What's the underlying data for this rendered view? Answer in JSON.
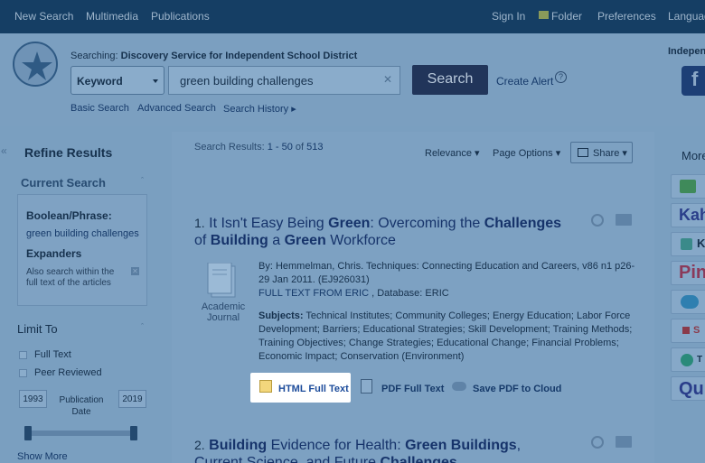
{
  "topnav": {
    "new_search": "New Search",
    "multimedia": "Multimedia",
    "publications": "Publications",
    "sign_in": "Sign In",
    "folder": "Folder",
    "preferences": "Preferences",
    "languages": "Languag"
  },
  "search": {
    "searching_prefix": "Searching:",
    "searching_target": "Discovery Service for Independent School District",
    "field": "Keyword",
    "query": "green building challenges",
    "button": "Search",
    "create_alert": "Create Alert",
    "help": "?",
    "basic": "Basic Search",
    "advanced": "Advanced Search",
    "history": "Search History ▸"
  },
  "header_right": {
    "independ": "Indepen",
    "facebook": "f"
  },
  "sidebar": {
    "collapse": "«",
    "refine_title": "Refine Results",
    "current_search": "Current Search",
    "boolean_label": "Boolean/Phrase:",
    "boolean_value": "green building challenges",
    "expanders_label": "Expanders",
    "expanders_value": "Also search within the full text of the articles",
    "limit_to": "Limit To",
    "full_text": "Full Text",
    "peer_reviewed": "Peer Reviewed",
    "year_from": "1993",
    "year_to": "2019",
    "pub_date": "Publication Date",
    "show_more": "Show More",
    "date_range": [
      0,
      1
    ]
  },
  "results_bar": {
    "prefix": "Search Results: ",
    "range": "1 - 50",
    "of": " of ",
    "total": "513",
    "relevance": "Relevance ▾",
    "page_options": "Page Options ▾",
    "share": "Share ▾"
  },
  "results": [
    {
      "num": "1.",
      "t1": "It Isn't Easy Being ",
      "t2": "Green",
      "t3": ": Overcoming the ",
      "t4": "Challenges",
      "t5": "of ",
      "t6": "Building",
      "t7": " a ",
      "t8": "Green",
      "t9": " Workforce",
      "pub_type": "Academic Journal",
      "byline": "By: Hemmelman, Chris. Techniques: Connecting Education and Careers, v86 n1 p26-29 Jan 2011. (EJ926031)",
      "fulltext_from": "FULL TEXT FROM ERIC",
      "database": " , Database: ERIC",
      "subjects_label": "Subjects:",
      "subjects": " Technical Institutes; Community Colleges; Energy Education; Labor Force Development; Barriers; Educational Strategies; Skill Development; Training Methods; Training Objectives; Change Strategies; Educational Change; Financial Problems; Economic Impact; Conservation (Environment)",
      "html_full_text": "HTML Full Text",
      "pdf_full_text": "PDF Full Text",
      "save_pdf": "Save PDF to Cloud"
    },
    {
      "num": "2.",
      "t1": "Building",
      "t2": " Evidence for Health: ",
      "t3": "Green Buildings",
      "t4": ",",
      "t5": "Current Science, and Future ",
      "t6": "Challenges"
    }
  ],
  "rightbar": {
    "more": "More",
    "tiles": [
      "",
      "Kah",
      "K",
      "Pin",
      "",
      "S",
      "T",
      "Qu"
    ]
  },
  "colors": {
    "topbar": "#153e64",
    "overlay_bg": "#7a9fc0",
    "search_button": "#21355a",
    "link": "#163a6a"
  }
}
